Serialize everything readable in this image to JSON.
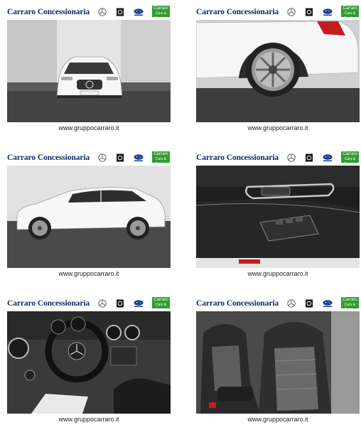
{
  "cards": [
    {
      "brand": "Carraro Concessionaria",
      "badge_line1": "Carraro",
      "badge_line2": "Cars & Service",
      "caption": "www.gruppocarraro.it"
    },
    {
      "brand": "Carraro Concessionaria",
      "badge_line1": "Carraro",
      "badge_line2": "Cars & Service",
      "caption": "www.gruppocarraro.it"
    },
    {
      "brand": "Carraro Concessionaria",
      "badge_line1": "Carraro",
      "badge_line2": "Cars & Service",
      "caption": "www.gruppocarraro.it"
    },
    {
      "brand": "Carraro Concessionaria",
      "badge_line1": "Carraro",
      "badge_line2": "Cars & Service",
      "caption": "www.gruppocarraro.it"
    },
    {
      "brand": "Carraro Concessionaria",
      "badge_line1": "Carraro",
      "badge_line2": "Cars & Service",
      "caption": "www.gruppocarraro.it"
    },
    {
      "brand": "Carraro Concessionaria",
      "badge_line1": "Carraro",
      "badge_line2": "Cars & Service",
      "caption": "www.gruppocarraro.it"
    }
  ],
  "icons": {
    "mercedes": "mercedes-star-icon",
    "hyundai": "dealer-logo-icon",
    "subaru": "subaru-logo-icon",
    "carraro": "carraro-badge-icon"
  },
  "colors": {
    "brand_blue": "#0b2a66",
    "badge_green": "#2f9e2f",
    "car_white": "#f4f4f4"
  },
  "photos": [
    "car-front-photo",
    "rear-wheel-photo",
    "car-side-photo",
    "door-panel-photo",
    "dashboard-photo",
    "seats-photo"
  ]
}
